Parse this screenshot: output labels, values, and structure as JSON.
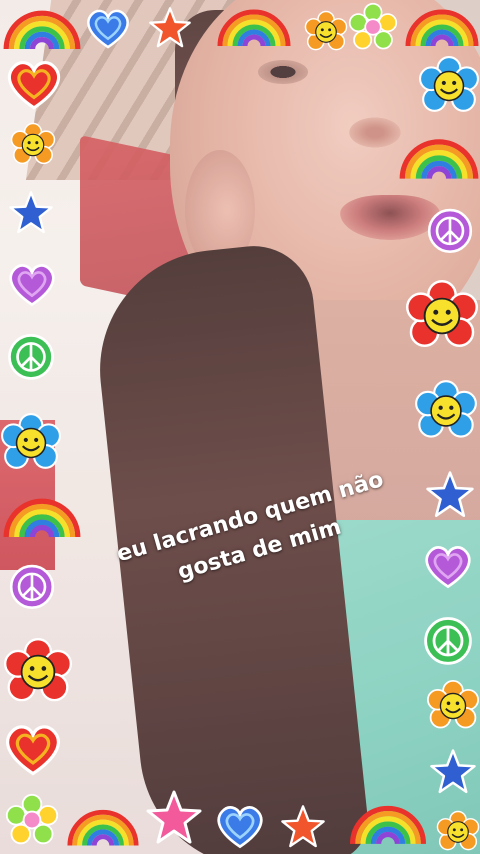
{
  "caption": {
    "line1": "eu lacrando quem não",
    "line2": "gosta de mim"
  },
  "stickers": {
    "rainbow": "rainbow-sticker",
    "heart": "heart-sticker",
    "star": "star-sticker",
    "smiley_flower": "smiley-flower-sticker",
    "flower": "flower-sticker",
    "peace": "peace-sign-sticker"
  },
  "colors": {
    "caption_text": "#ffffff",
    "shirt": "#8fd6c4",
    "red_heart": "#e8322b",
    "blue_star": "#2f5fd0",
    "purple_heart": "#b45ad8"
  }
}
